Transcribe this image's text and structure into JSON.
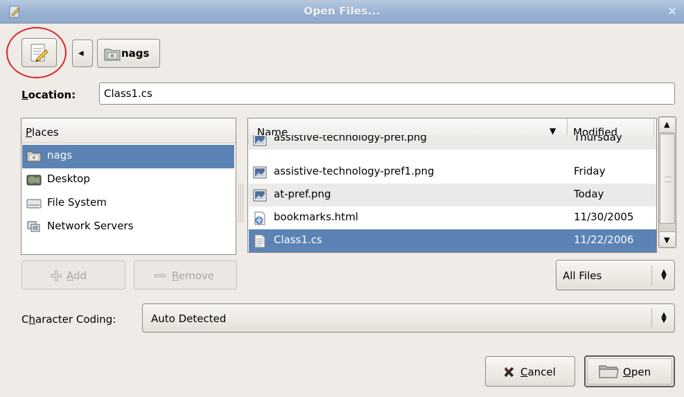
{
  "window": {
    "title": "Open Files...",
    "close_glyph": "×"
  },
  "toolbar": {
    "path_button_label": "nags",
    "back_arrow": "◂"
  },
  "location": {
    "label_underlined": "L",
    "label_rest": "ocation:",
    "value": "Class1.cs"
  },
  "places": {
    "header_underlined": "P",
    "header_rest": "laces",
    "items": [
      {
        "label": "nags",
        "icon": "home-folder-icon",
        "selected": true
      },
      {
        "label": "Desktop",
        "icon": "desktop-icon",
        "selected": false
      },
      {
        "label": "File System",
        "icon": "drive-icon",
        "selected": false
      },
      {
        "label": "Network Servers",
        "icon": "network-icon",
        "selected": false
      }
    ],
    "add_button": {
      "underlined": "A",
      "rest": "dd"
    },
    "remove_button": {
      "underlined": "R",
      "rest": "emove"
    }
  },
  "files": {
    "col_name": "Name",
    "col_modified": "Modified",
    "rows": [
      {
        "name": "assistive-technology-pref.png",
        "modified": "Thursday",
        "icon": "image-file-icon"
      },
      {
        "name": "assistive-technology-pref1.png",
        "modified": "Friday",
        "icon": "image-file-icon"
      },
      {
        "name": "at-pref.png",
        "modified": "Today",
        "icon": "image-file-icon"
      },
      {
        "name": "bookmarks.html",
        "modified": "11/30/2005",
        "icon": "html-file-icon"
      },
      {
        "name": "Class1.cs",
        "modified": "11/22/2006",
        "icon": "text-file-icon",
        "selected": true
      }
    ],
    "filter": "All Files"
  },
  "encoding": {
    "label_pre": "C",
    "label_underlined": "h",
    "label_rest": "aracter Coding:",
    "value": "Auto Detected"
  },
  "buttons": {
    "cancel": {
      "underlined": "C",
      "rest": "ancel"
    },
    "open": {
      "underlined": "O",
      "rest": "pen"
    }
  },
  "colors": {
    "selection": "#5b83b4",
    "titlebar": "#9bb4d4",
    "annotation": "#d82424"
  }
}
